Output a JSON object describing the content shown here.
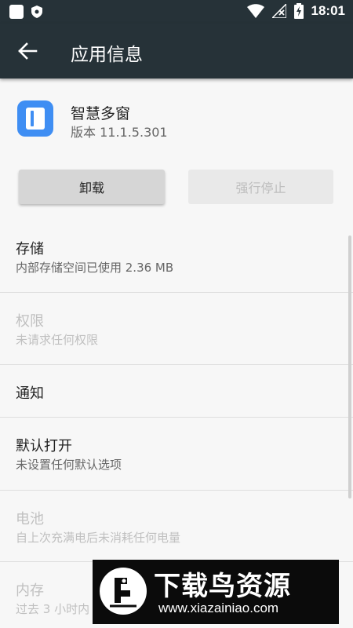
{
  "status_bar": {
    "time": "18:01",
    "icons": [
      "app-square-icon",
      "shield-icon",
      "wifi-icon",
      "no-signal-icon",
      "battery-charging-icon"
    ]
  },
  "toolbar": {
    "back_icon": "arrow-left-icon",
    "title": "应用信息"
  },
  "app": {
    "icon": "smart-multiwindow-icon",
    "icon_color": "#3f8ef3",
    "name": "智慧多窗",
    "version": "版本 11.1.5.301"
  },
  "buttons": {
    "uninstall": "卸载",
    "force_stop": "强行停止"
  },
  "sections": [
    {
      "title": "存储",
      "subtitle": "内部存储空间已使用 2.36 MB",
      "enabled": true
    },
    {
      "title": "权限",
      "subtitle": "未请求任何权限",
      "enabled": false
    },
    {
      "title": "通知",
      "subtitle": "",
      "enabled": true
    },
    {
      "title": "默认打开",
      "subtitle": "未设置任何默认选项",
      "enabled": true
    },
    {
      "title": "电池",
      "subtitle": "自上次充满电后未消耗任何电量",
      "enabled": false
    },
    {
      "title": "内存",
      "subtitle": "过去 3 小时内",
      "enabled": false
    }
  ],
  "watermark": {
    "title": "下载鸟资源",
    "url": "www.xiazainiao.com"
  },
  "colors": {
    "toolbar_bg": "#263238",
    "page_bg": "#f7f7f7"
  }
}
